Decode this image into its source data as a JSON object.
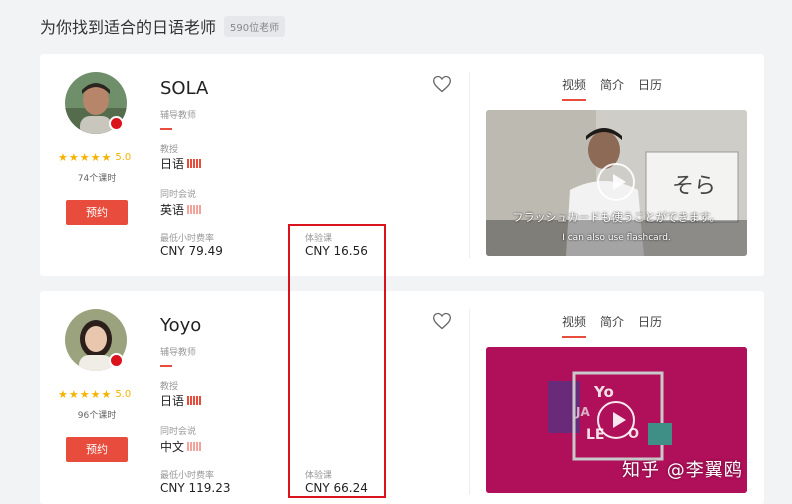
{
  "header": {
    "title": "为你找到适合的日语老师",
    "count": "590位老师"
  },
  "teachers": [
    {
      "name": "SOLA",
      "role": "辅导教师",
      "rating": "5.0",
      "stars": "★★★★★",
      "lessons": "74个课时",
      "book_label": "预约",
      "teaches_label": "教授",
      "teaches": "日语",
      "also_speaks_label": "同时会说",
      "also_speaks": "英语",
      "min_rate_label": "最低小时费率",
      "min_rate": "CNY 79.49",
      "trial_label": "体验课",
      "trial": "CNY 16.56",
      "tabs": [
        "视频",
        "简介",
        "日历"
      ],
      "video_caption_jp": "フラッシュカードも使うことができます。",
      "video_caption_en": "I can also use flashcard.",
      "board_text": "そら"
    },
    {
      "name": "Yoyo",
      "role": "辅导教师",
      "rating": "5.0",
      "stars": "★★★★★",
      "lessons": "96个课时",
      "book_label": "预约",
      "teaches_label": "教授",
      "teaches": "日语",
      "also_speaks_label": "同时会说",
      "also_speaks": "中文",
      "min_rate_label": "最低小时费率",
      "min_rate": "CNY 119.23",
      "trial_label": "体验课",
      "trial": "CNY 66.24",
      "tabs": [
        "视频",
        "简介",
        "日历"
      ],
      "video_text": {
        "t1": "Yo",
        "t2": "JA",
        "t3": "LE",
        "t4": "O"
      }
    }
  ],
  "watermark": "知乎 @李翼鸥",
  "colors": {
    "accent": "#e74c3c",
    "star": "#f5b301",
    "highlight": "#d9121b",
    "video2_bg": "#b0105a"
  }
}
